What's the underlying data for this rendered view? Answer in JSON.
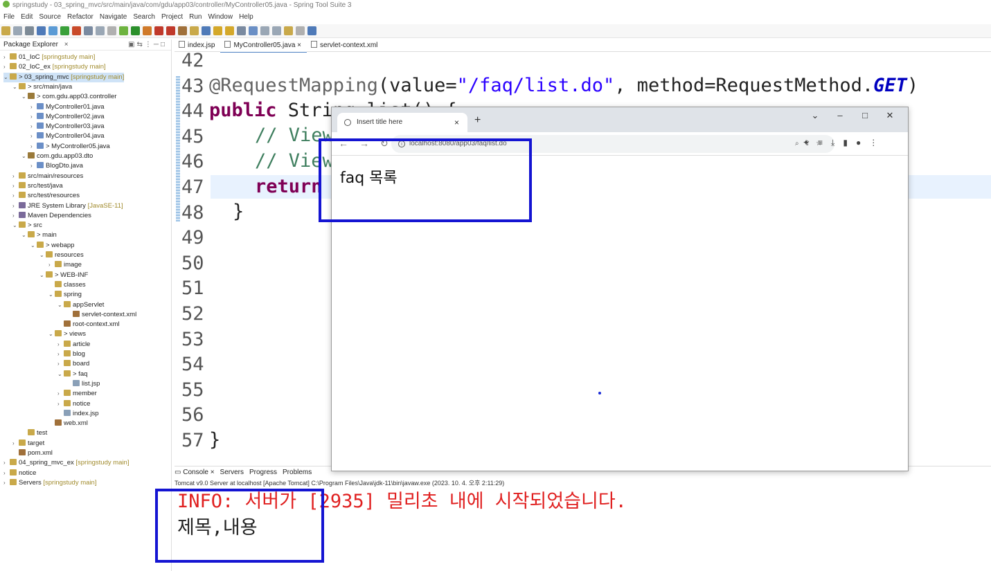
{
  "window": {
    "title": "springstudy - 03_spring_mvc/src/main/java/com/gdu/app03/controller/MyController05.java - Spring Tool Suite 3"
  },
  "menu": [
    "File",
    "Edit",
    "Source",
    "Refactor",
    "Navigate",
    "Search",
    "Project",
    "Run",
    "Window",
    "Help"
  ],
  "explorer": {
    "title": "Package Explorer",
    "items": [
      {
        "label": "01_IoC",
        "sub": "[springstudy main]",
        "indent": 0,
        "tw": "›"
      },
      {
        "label": "02_IoC_ex",
        "sub": "[springstudy main]",
        "indent": 0,
        "tw": "›"
      },
      {
        "label": "> 03_spring_mvc",
        "sub": "[springstudy main]",
        "indent": 0,
        "tw": "⌄",
        "sel": true
      },
      {
        "label": "> src/main/java",
        "sub": "",
        "indent": 1,
        "tw": "⌄"
      },
      {
        "label": "> com.gdu.app03.controller",
        "sub": "",
        "indent": 2,
        "tw": "⌄"
      },
      {
        "label": "MyController01.java",
        "sub": "",
        "indent": 3,
        "tw": "›"
      },
      {
        "label": "MyController02.java",
        "sub": "",
        "indent": 3,
        "tw": "›"
      },
      {
        "label": "MyController03.java",
        "sub": "",
        "indent": 3,
        "tw": "›"
      },
      {
        "label": "MyController04.java",
        "sub": "",
        "indent": 3,
        "tw": "›"
      },
      {
        "label": "> MyController05.java",
        "sub": "",
        "indent": 3,
        "tw": "›"
      },
      {
        "label": "com.gdu.app03.dto",
        "sub": "",
        "indent": 2,
        "tw": "⌄"
      },
      {
        "label": "BlogDto.java",
        "sub": "",
        "indent": 3,
        "tw": "›"
      },
      {
        "label": "src/main/resources",
        "sub": "",
        "indent": 1,
        "tw": "›"
      },
      {
        "label": "src/test/java",
        "sub": "",
        "indent": 1,
        "tw": "›"
      },
      {
        "label": "src/test/resources",
        "sub": "",
        "indent": 1,
        "tw": "›"
      },
      {
        "label": "JRE System Library",
        "sub": "[JavaSE-11]",
        "indent": 1,
        "tw": "›"
      },
      {
        "label": "Maven Dependencies",
        "sub": "",
        "indent": 1,
        "tw": "›"
      },
      {
        "label": "> src",
        "sub": "",
        "indent": 1,
        "tw": "⌄"
      },
      {
        "label": "> main",
        "sub": "",
        "indent": 2,
        "tw": "⌄"
      },
      {
        "label": "> webapp",
        "sub": "",
        "indent": 3,
        "tw": "⌄"
      },
      {
        "label": "resources",
        "sub": "",
        "indent": 4,
        "tw": "⌄"
      },
      {
        "label": "image",
        "sub": "",
        "indent": 5,
        "tw": "›"
      },
      {
        "label": "> WEB-INF",
        "sub": "",
        "indent": 4,
        "tw": "⌄"
      },
      {
        "label": "classes",
        "sub": "",
        "indent": 5,
        "tw": ""
      },
      {
        "label": "spring",
        "sub": "",
        "indent": 5,
        "tw": "⌄"
      },
      {
        "label": "appServlet",
        "sub": "",
        "indent": 6,
        "tw": "⌄"
      },
      {
        "label": "servlet-context.xml",
        "sub": "",
        "indent": 7,
        "tw": ""
      },
      {
        "label": "root-context.xml",
        "sub": "",
        "indent": 6,
        "tw": ""
      },
      {
        "label": "> views",
        "sub": "",
        "indent": 5,
        "tw": "⌄"
      },
      {
        "label": "article",
        "sub": "",
        "indent": 6,
        "tw": "›"
      },
      {
        "label": "blog",
        "sub": "",
        "indent": 6,
        "tw": "›"
      },
      {
        "label": "board",
        "sub": "",
        "indent": 6,
        "tw": "›"
      },
      {
        "label": "> faq",
        "sub": "",
        "indent": 6,
        "tw": "⌄"
      },
      {
        "label": "list.jsp",
        "sub": "",
        "indent": 7,
        "tw": ""
      },
      {
        "label": "member",
        "sub": "",
        "indent": 6,
        "tw": "›"
      },
      {
        "label": "notice",
        "sub": "",
        "indent": 6,
        "tw": "›"
      },
      {
        "label": "index.jsp",
        "sub": "",
        "indent": 6,
        "tw": ""
      },
      {
        "label": "web.xml",
        "sub": "",
        "indent": 5,
        "tw": ""
      },
      {
        "label": "test",
        "sub": "",
        "indent": 2,
        "tw": ""
      },
      {
        "label": "target",
        "sub": "",
        "indent": 1,
        "tw": "›"
      },
      {
        "label": "pom.xml",
        "sub": "",
        "indent": 1,
        "tw": ""
      },
      {
        "label": "04_spring_mvc_ex",
        "sub": "[springstudy main]",
        "indent": 0,
        "tw": "›"
      },
      {
        "label": "notice",
        "sub": "",
        "indent": 0,
        "tw": "›"
      },
      {
        "label": "Servers",
        "sub": "[springstudy main]",
        "indent": 0,
        "tw": "›"
      }
    ]
  },
  "editor": {
    "tabs": [
      {
        "label": "index.jsp",
        "active": false
      },
      {
        "label": "MyController05.java",
        "active": true
      },
      {
        "label": "servlet-context.xml",
        "active": false
      }
    ],
    "line_numbers": [
      "42",
      "43",
      "44",
      "45",
      "46",
      "47",
      "48",
      "49",
      "50",
      "51",
      "52",
      "53",
      "54",
      "55",
      "56",
      "57"
    ],
    "code": {
      "l43_ann": "@RequestMapping",
      "l43_a": "(value=",
      "l43_str": "\"/faq/list.do\"",
      "l43_b": ", method=RequestMethod.",
      "l43_get": "GET",
      "l43_c": ")",
      "l44_kw": "public",
      "l44_rest": " St",
      "l44_tail": "ring list() {",
      "l45": "// View",
      "l46": "// View",
      "l47": "return",
      "l48": "}",
      "l57": "}"
    }
  },
  "console": {
    "tabs": [
      "Console",
      "Servers",
      "Progress",
      "Problems"
    ],
    "status": "Tomcat v9.0 Server at localhost [Apache Tomcat] C:\\Program Files\\Java\\jdk-11\\bin\\javaw.exe  (2023. 10. 4. 오후 2:11:29)",
    "line1": "INFO: 서버가 [2935] 밀리초 내에 시작되었습니다.",
    "line2": "제목,내용"
  },
  "browser": {
    "tab_title": "Insert title here",
    "url": "localhost:8080/app03/faq/list.do",
    "page_text": "faq 목록"
  }
}
